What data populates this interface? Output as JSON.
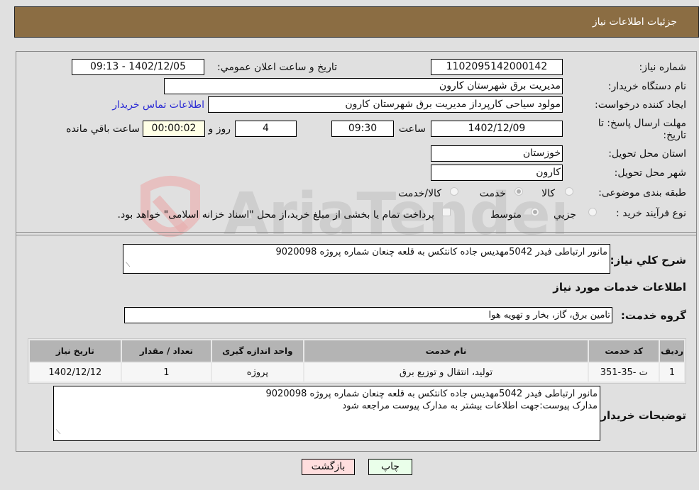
{
  "header": {
    "title": "جزئیات اطلاعات نیاز"
  },
  "form": {
    "need_number_label": "شماره نیاز:",
    "need_number": "1102095142000142",
    "announce_label": "تاریخ و ساعت اعلان عمومي:",
    "announce_value": "1402/12/05 - 09:13",
    "buyer_org_label": "نام دستگاه خریدار:",
    "buyer_org": "مدیریت برق شهرستان کارون",
    "creator_label": "ایجاد کننده درخواست:",
    "creator": "مولود سیاحی کارپرداز مدیریت برق شهرستان کارون",
    "buyer_contact_link": "اطلاعات تماس خریدار",
    "deadline_label": "مهلت ارسال پاسخ: تا تاریخ:",
    "deadline_date": "1402/12/09",
    "time_label": "ساعت",
    "deadline_time": "09:30",
    "days_value": "4",
    "days_label": "روز و",
    "remaining_time": "00:00:02",
    "remaining_label": "ساعت باقي مانده",
    "province_label": "استان محل تحویل:",
    "province": "خوزستان",
    "city_label": "شهر محل تحویل:",
    "city": "کارون",
    "category_label": "طبقه بندی موضوعی:",
    "category_options": [
      "کالا",
      "خدمت",
      "کالا/خدمت"
    ],
    "category_selected": "خدمت",
    "process_label": "نوع فرآیند خرید :",
    "process_options": [
      "جزيي",
      "متوسط"
    ],
    "process_selected": "متوسط",
    "treasury_note": "پرداخت تمام یا بخشی از مبلغ خرید،از محل \"اسناد خزانه اسلامی\" خواهد بود.",
    "summary_label": "شرح كلي نياز:",
    "summary": "مانور ارتباطی فیدر 5042مهدیس جاده کانتکس به قلعه چنعان شماره پروژه 9020098",
    "services_section_title": "اطلاعات خدمات مورد نیاز",
    "service_group_label": "گروه خدمت:",
    "service_group": "تامین برق، گاز، بخار و تهویه هوا"
  },
  "table": {
    "headers": [
      "ردیف",
      "کد خدمت",
      "نام خدمت",
      "واحد اندازه گیری",
      "تعداد / مقدار",
      "تاریخ نیاز"
    ],
    "rows": [
      [
        "1",
        "ت -35-351",
        "تولید، انتقال و توزیع برق",
        "پروژه",
        "1",
        "1402/12/12"
      ]
    ]
  },
  "buyer_notes": {
    "label": "توضیحات خریدار:",
    "line1": "مانور ارتباطی فیدر 5042مهدیس جاده کانتکس به قلعه چنعان شماره پروژه 9020098",
    "line2": "مدارک پیوست:جهت اطلاعات بیشتر به مدارک پیوست مراجعه شود"
  },
  "buttons": {
    "print": "چاپ",
    "back": "بازگشت"
  },
  "colors": {
    "header_bg": "#8b6d43",
    "link": "#2a2ad4",
    "print_bg": "#eaffea",
    "back_bg": "#ffdede"
  }
}
